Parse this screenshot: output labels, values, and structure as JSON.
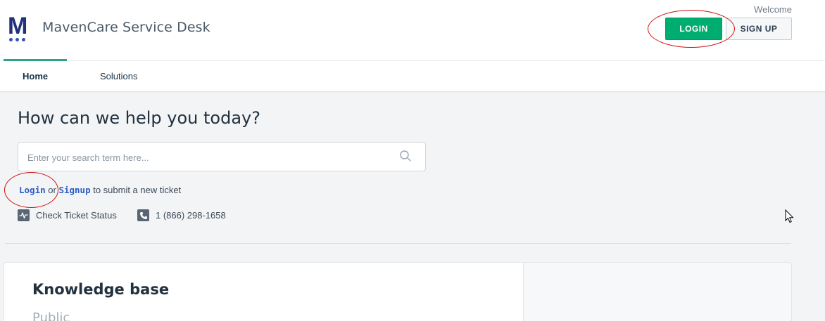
{
  "header": {
    "logo_letter": "M",
    "app_title": "MavenCare Service Desk",
    "welcome": "Welcome",
    "login_label": "LOGIN",
    "signup_label": "SIGN UP"
  },
  "nav": {
    "tabs": [
      {
        "label": "Home",
        "active": true
      },
      {
        "label": "Solutions",
        "active": false
      }
    ]
  },
  "main": {
    "heading": "How can we help you today?",
    "search": {
      "placeholder": "Enter your search term here...",
      "value": ""
    },
    "login_line": {
      "login_link": "Login",
      "or_text": " or ",
      "signup_link": "Signup",
      "suffix": " to submit a new ticket"
    },
    "quick_links": [
      {
        "icon": "pulse-icon",
        "label": "Check Ticket Status"
      },
      {
        "icon": "phone-icon",
        "label": "1 (866) 298-1658"
      }
    ]
  },
  "knowledge_base": {
    "title": "Knowledge base",
    "subtitle": "Public"
  },
  "colors": {
    "primary": "#00ad71",
    "brand": "#23307a",
    "link": "#2c5cc5",
    "annotation": "#d01010"
  }
}
